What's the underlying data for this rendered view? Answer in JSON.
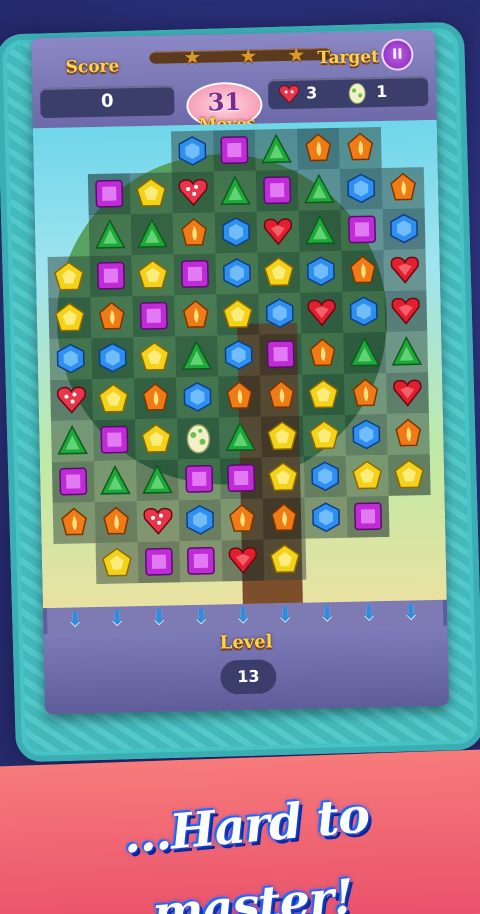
{
  "hud": {
    "score_label": "Score",
    "score_value": "0",
    "target_label": "Target",
    "moves_value": "31",
    "moves_label": "Moves",
    "pause_label": "II",
    "target_items": [
      {
        "icon": "red-heart-gem-icon",
        "count": "3"
      },
      {
        "icon": "egg-icon",
        "count": "1"
      }
    ],
    "star_count": 3,
    "progress_fraction": 0.0
  },
  "board": {
    "rows": [
      [
        ".",
        ".",
        ".",
        "BH",
        "PS",
        "GT",
        "OF",
        "OF",
        "."
      ],
      [
        ".",
        "PS",
        "YP",
        "RL",
        "GT",
        "PS",
        "GT",
        "BH",
        "OF"
      ],
      [
        ".",
        "GT",
        "GT",
        "OF",
        "BH",
        "RH",
        "GT",
        "PS",
        "BH"
      ],
      [
        "YP",
        "PS",
        "YP",
        "PS",
        "BH",
        "YP",
        "BH",
        "OF",
        "RH"
      ],
      [
        "YP",
        "OF",
        "PS",
        "OF",
        "YP",
        "BH",
        "RH",
        "BH",
        "RH"
      ],
      [
        "BH",
        "BH",
        "YP",
        "GT",
        "BH",
        "PS",
        "OF",
        "GT",
        "GT"
      ],
      [
        "RL",
        "YP",
        "OF",
        "BH",
        "OF",
        "OF",
        "YP",
        "OF",
        "RH"
      ],
      [
        "GT",
        "PS",
        "YP",
        "EG",
        "GT",
        "YP",
        "YP",
        "BH",
        "OF"
      ],
      [
        "PS",
        "GT",
        "GT",
        "PS",
        "PS",
        "YP",
        "BH",
        "YP",
        "YP"
      ],
      [
        "OF",
        "OF",
        "RL",
        "BH",
        "OF",
        "OF",
        "BH",
        "PS",
        "."
      ],
      [
        ".",
        "YP",
        "PS",
        "PS",
        "RH",
        "YP",
        ".",
        ".",
        "."
      ]
    ],
    "gem_colors": {
      "BH": "#2e8ff0",
      "PS": "#c02bd8",
      "GT": "#1ea83a",
      "OF": "#f07b16",
      "YP": "#f5d21a",
      "RH": "#e0202e",
      "RL": "#e8354a",
      "EG": "#f2f0c8"
    }
  },
  "level": {
    "label": "Level",
    "value": "13"
  },
  "tagline": "...Hard to master!"
}
